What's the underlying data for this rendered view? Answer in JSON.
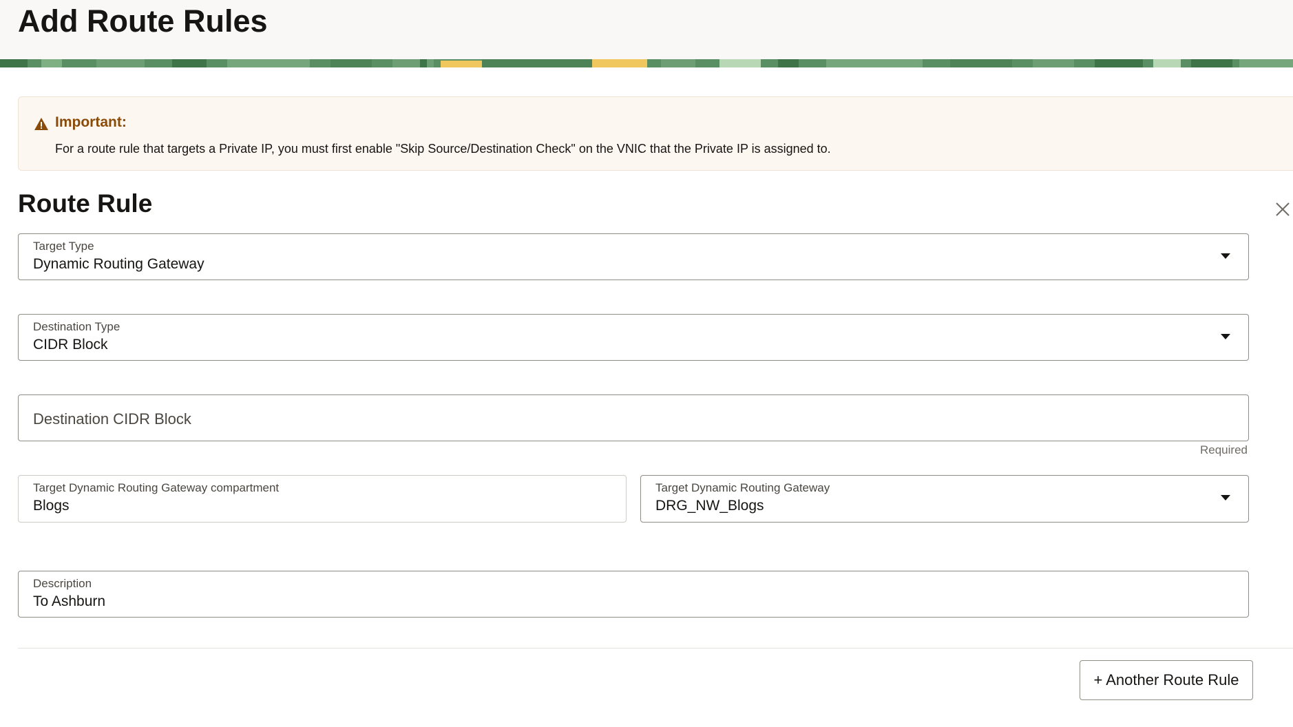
{
  "page": {
    "title": "Add Route Rules"
  },
  "notice": {
    "icon": "warning-icon",
    "title": "Important:",
    "body": "For a route rule that targets a Private IP, you must first enable \"Skip Source/Destination Check\" on the VNIC that the Private IP is assigned to."
  },
  "route_rule": {
    "section_title": "Route Rule",
    "close_icon": "close-icon",
    "target_type": {
      "label": "Target Type",
      "value": "Dynamic Routing Gateway"
    },
    "destination_type": {
      "label": "Destination Type",
      "value": "CIDR Block"
    },
    "destination_cidr": {
      "placeholder": "Destination CIDR Block",
      "helper": "Required"
    },
    "target_compartment": {
      "label": "Target Dynamic Routing Gateway compartment",
      "value": "Blogs"
    },
    "target_drg": {
      "label": "Target Dynamic Routing Gateway",
      "value": "DRG_NW_Blogs"
    },
    "description": {
      "label": "Description",
      "value": "To Ashburn"
    }
  },
  "actions": {
    "another_rule_label": "+ Another Route Rule"
  },
  "colors": {
    "notice_title": "#8a4b08",
    "notice_background": "#fdf7f1",
    "banner_green": "#5a8f63",
    "banner_yellow": "#f0c75e"
  }
}
